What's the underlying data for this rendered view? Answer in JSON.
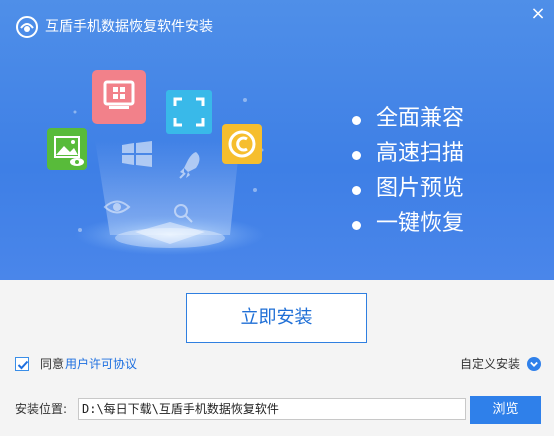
{
  "window": {
    "title": "互盾手机数据恢复软件安装",
    "close_label": "×"
  },
  "hero": {
    "features": [
      "全面兼容",
      "高速扫描",
      "图片预览",
      "一键恢复"
    ],
    "icons": [
      "image-icon",
      "computer-windows-icon",
      "scan-icon",
      "copyright-icon",
      "windows-icon",
      "rocket-icon",
      "eye-icon",
      "magnifier-icon"
    ]
  },
  "install": {
    "button_label": "立即安装"
  },
  "agreement": {
    "checked": true,
    "prefix": "同意",
    "link_label": "用户许可协议"
  },
  "options": {
    "custom_install_label": "自定义安装"
  },
  "path": {
    "label": "安装位置:",
    "value": "D:\\每日下载\\互盾手机数据恢复软件",
    "browse_label": "浏览"
  },
  "colors": {
    "hero_blue": "#4a86ea",
    "button_blue": "#2f80ea",
    "link_blue": "#1d6fe0"
  }
}
